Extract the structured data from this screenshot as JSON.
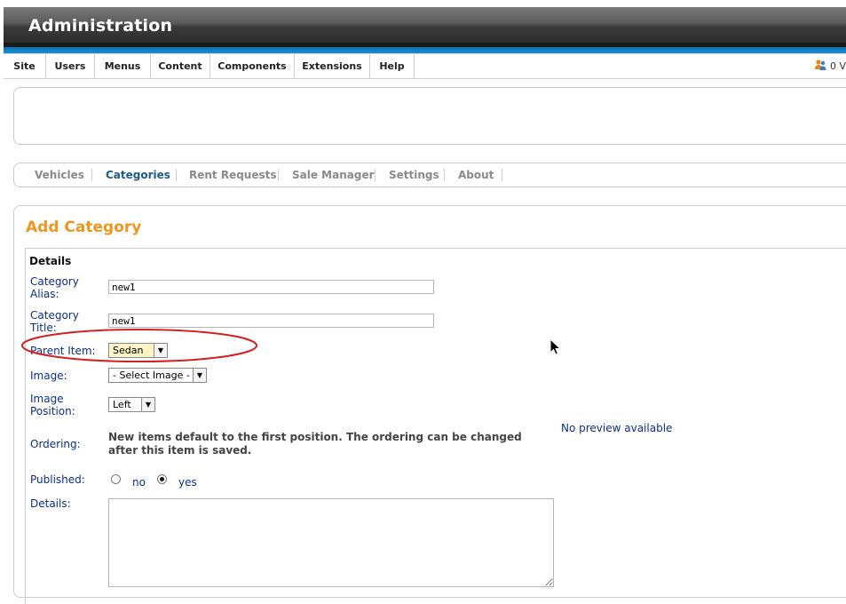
{
  "header": {
    "title": "Administration"
  },
  "menubar": {
    "items": [
      "Site",
      "Users",
      "Menus",
      "Content",
      "Components",
      "Extensions",
      "Help"
    ],
    "online_count": "0 V"
  },
  "submenu": {
    "tabs": [
      "Vehicles",
      "Categories",
      "Rent Requests",
      "Sale Manager",
      "Settings",
      "About"
    ],
    "active": "Categories"
  },
  "page": {
    "title": "Add Category",
    "legend": "Details"
  },
  "form": {
    "category_alias": {
      "label": "Category Alias:",
      "value": "new1"
    },
    "category_title": {
      "label": "Category Title:",
      "value": "new1"
    },
    "parent_item": {
      "label": "Parent Item:",
      "value": "Sedan"
    },
    "image": {
      "label": "Image:",
      "value": "- Select Image -"
    },
    "image_position": {
      "label": "Image Position:",
      "value": "Left"
    },
    "ordering": {
      "label": "Ordering:",
      "note": "New items default to the first position. The ordering can be changed after this item is saved."
    },
    "preview_text": "No preview available",
    "published": {
      "label": "Published:",
      "no_label": "no",
      "yes_label": "yes",
      "selected": "yes"
    },
    "details": {
      "label": "Details:",
      "value": ""
    }
  },
  "colors": {
    "accent_orange": "#f0961e",
    "label_blue": "#0c2f8a",
    "active_tab": "#1b5b8a",
    "annotation_red": "#d42020"
  }
}
